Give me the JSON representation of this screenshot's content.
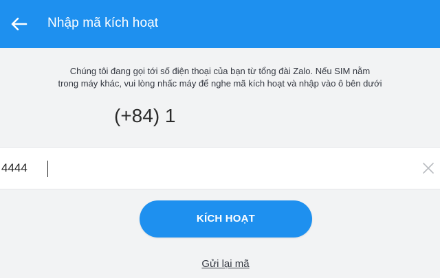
{
  "header": {
    "back_icon": "arrow-left-icon",
    "title": "Nhập mã kích hoạt"
  },
  "instruction": {
    "line1": "Chúng tôi đang gọi tới số điện thoại của bạn từ tổng đài Zalo. Nếu SIM nằm",
    "line2": "trong máy khác, vui lòng nhấc máy để nghe mã kích hoạt và nhập vào ô bên dưới"
  },
  "phone": {
    "number": "(+84) 1"
  },
  "code_field": {
    "value": "4444",
    "clear_icon": "close-icon"
  },
  "actions": {
    "activate_label": "KÍCH HOẠT",
    "resend_label": "Gửi lại mã"
  },
  "colors": {
    "primary": "#1e90ef",
    "background": "#f2f3f4",
    "text": "#333740"
  }
}
